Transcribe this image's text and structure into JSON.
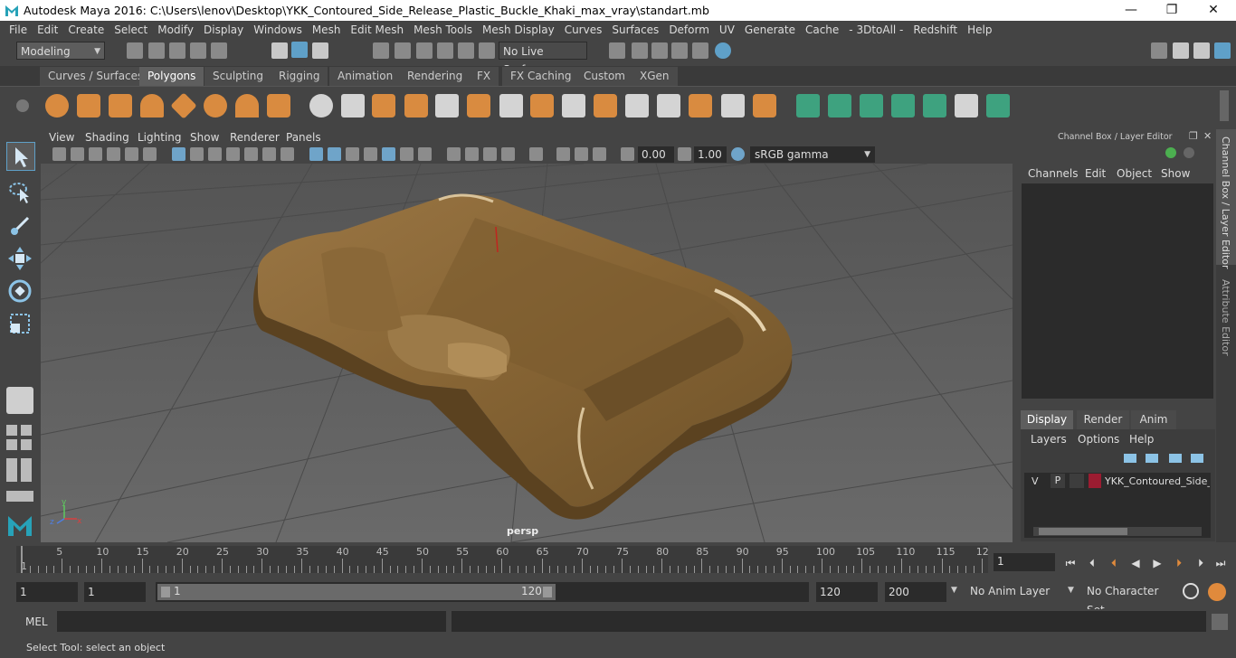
{
  "window": {
    "title": "Autodesk Maya 2016: C:\\Users\\lenov\\Desktop\\YKK_Contoured_Side_Release_Plastic_Buckle_Khaki_max_vray\\standart.mb",
    "minimize": "—",
    "restore": "❐",
    "close": "✕"
  },
  "menubar": [
    "File",
    "Edit",
    "Create",
    "Select",
    "Modify",
    "Display",
    "Windows",
    "Mesh",
    "Edit Mesh",
    "Mesh Tools",
    "Mesh Display",
    "Curves",
    "Surfaces",
    "Deform",
    "UV",
    "Generate",
    "Cache",
    "- 3DtoAll -",
    "Redshift",
    "Help"
  ],
  "statusline": {
    "mode": "Modeling",
    "live_surface": "No Live Surface"
  },
  "shelf_tabs": [
    {
      "label": "Curves / Surfaces",
      "active": false
    },
    {
      "label": "Polygons",
      "active": true
    },
    {
      "label": "Sculpting",
      "active": false
    },
    {
      "label": "Rigging",
      "active": false
    },
    {
      "label": "Animation",
      "active": false
    },
    {
      "label": "Rendering",
      "active": false
    },
    {
      "label": "FX",
      "active": false
    },
    {
      "label": "FX Caching",
      "active": false
    },
    {
      "label": "Custom",
      "active": false
    },
    {
      "label": "XGen",
      "active": false
    }
  ],
  "viewport": {
    "menus": [
      "View",
      "Shading",
      "Lighting",
      "Show",
      "Renderer",
      "Panels"
    ],
    "exposure": "0.00",
    "gamma": "1.00",
    "color_space": "sRGB gamma",
    "camera_label": "persp",
    "axis_y": "y",
    "axis_x": "x",
    "axis_z": "z"
  },
  "channel_box": {
    "title": "Channel Box / Layer Editor",
    "menus": [
      "Channels",
      "Edit",
      "Object",
      "Show"
    ]
  },
  "layer_editor": {
    "tabs": [
      "Display",
      "Render",
      "Anim"
    ],
    "active_tab": "Display",
    "menus": [
      "Layers",
      "Options",
      "Help"
    ],
    "layer": {
      "v": "V",
      "p": "P",
      "name": "YKK_Contoured_Side_R",
      "color": "#9b1c31"
    }
  },
  "side_tabs": [
    "Channel Box / Layer Editor",
    "Attribute Editor"
  ],
  "timeline": {
    "ticks": [
      "1",
      "5",
      "10",
      "15",
      "20",
      "25",
      "30",
      "35",
      "40",
      "45",
      "50",
      "55",
      "60",
      "65",
      "70",
      "75",
      "80",
      "85",
      "90",
      "95",
      "100",
      "105",
      "110",
      "115",
      "12"
    ],
    "current_frame": "1"
  },
  "range": {
    "start": "1",
    "playback_start": "1",
    "slider_start": "1",
    "slider_end": "120",
    "playback_end": "120",
    "end": "200",
    "anim_layer": "No Anim Layer",
    "character_set": "No Character Set"
  },
  "command_line": {
    "label": "MEL"
  },
  "help_line": "Select Tool: select an object",
  "colors": {
    "model": "#8d6a3a",
    "accent": "#5fa0c8",
    "shelf_orange": "#d98b40",
    "shelf_teal": "#3ea27f"
  }
}
